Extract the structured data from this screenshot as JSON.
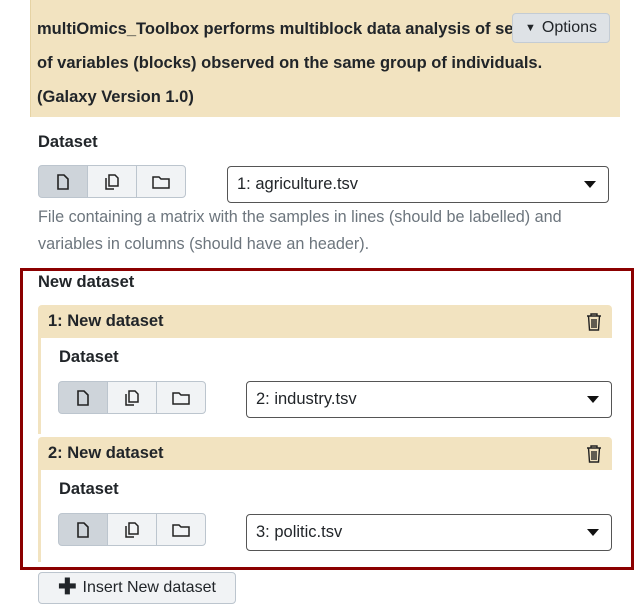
{
  "tool": {
    "title": "multiOmics_Toolbox performs multiblock data analysis of several sets of variables (blocks) observed on the same group of individuals. (Galaxy Version 1.0)",
    "options_label": "Options"
  },
  "dataset": {
    "label": "Dataset",
    "selected": "1: agriculture.tsv",
    "help": "File containing a matrix with the samples in lines (should be labelled) and variables in columns (should have an header)."
  },
  "new_dataset": {
    "section_label": "New dataset",
    "repeats": [
      {
        "title": "1: New dataset",
        "field_label": "Dataset",
        "selected": "2: industry.tsv"
      },
      {
        "title": "2: New dataset",
        "field_label": "Dataset",
        "selected": "3: politic.tsv"
      }
    ],
    "insert_label": "Insert New dataset"
  },
  "icons": [
    "file-icon",
    "files-icon",
    "folder-icon",
    "trash-icon",
    "plus-icon",
    "caret-down-icon"
  ],
  "colors": {
    "header_bg": "#f2e3c0",
    "highlight_border": "#8b0000",
    "help_text": "#6c757d"
  }
}
